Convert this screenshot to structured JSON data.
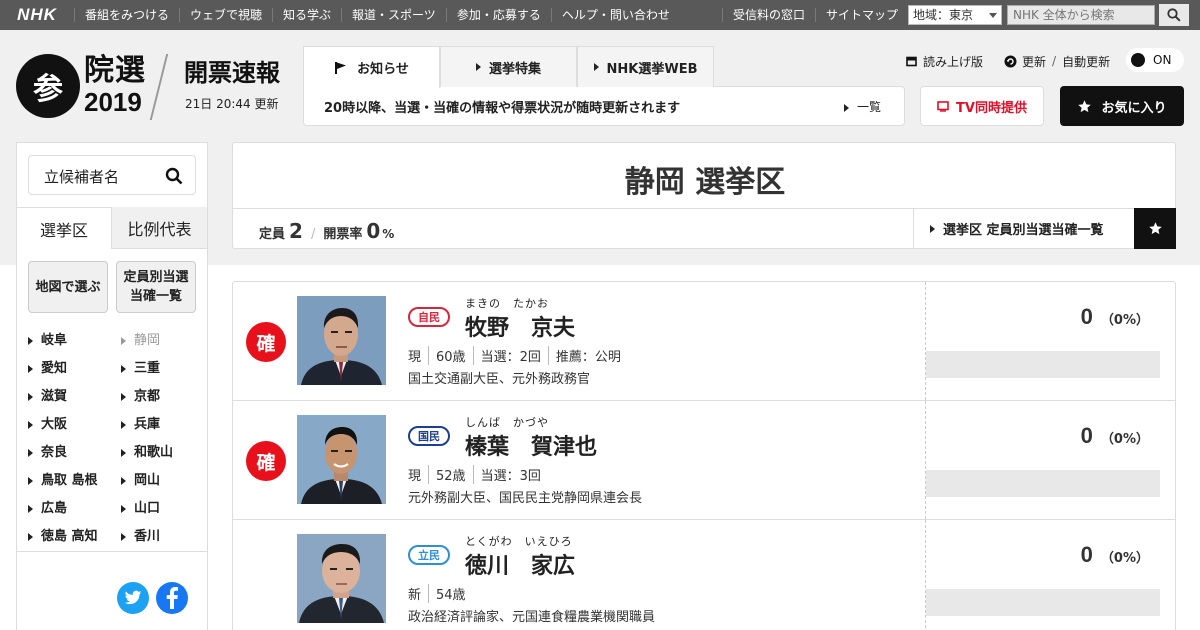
{
  "topbar": {
    "logo": "NHK",
    "nav": [
      "番組をみつける",
      "ウェブで視聴",
      "知る学ぶ",
      "報道・スポーツ",
      "参加・応募する",
      "ヘルプ・問い合わせ"
    ],
    "right_nav": [
      "受信料の窓口",
      "サイトマップ"
    ],
    "region_label": "地域：",
    "region_value": "東京",
    "search_placeholder": "NHK 全体から検索"
  },
  "header": {
    "logo_mark": "参",
    "logo_line1": "院選",
    "logo_line2": "2019",
    "title": "開票速報",
    "updated": "21日 20:44 更新",
    "tabs": [
      {
        "label": "お知らせ",
        "active": true
      },
      {
        "label": "選挙特集",
        "active": false
      },
      {
        "label": "NHK選挙WEB",
        "active": false
      }
    ],
    "news_text": "20時以降、当選・当確の情報や得票状況が随時更新されます",
    "news_list_link": "一覧",
    "read_aloud": "読み上げ版",
    "refresh": "更新",
    "auto_refresh": "自動更新",
    "toggle_state": "ON",
    "tv_button": "TV同時提供",
    "favorite_button": "お気に入り"
  },
  "sidebar": {
    "search_placeholder": "立候補者名",
    "tabs": [
      "選挙区",
      "比例代表"
    ],
    "buttons": [
      "地図で選ぶ",
      "定員別当選\n当確一覧"
    ],
    "prefectures": [
      [
        "岐阜",
        "静岡"
      ],
      [
        "愛知",
        "三重"
      ],
      [
        "滋賀",
        "京都"
      ],
      [
        "大阪",
        "兵庫"
      ],
      [
        "奈良",
        "和歌山"
      ],
      [
        "鳥取 島根",
        "岡山"
      ],
      [
        "広島",
        "山口"
      ],
      [
        "徳島 高知",
        "香川"
      ]
    ],
    "current_prefecture": "静岡"
  },
  "district": {
    "title": "静岡 選挙区",
    "seats_label": "定員",
    "seats": "2",
    "rate_label": "開票率",
    "rate": "0",
    "rate_unit": "%",
    "link": "選挙区 定員別当選当確一覧"
  },
  "candidates": [
    {
      "elected_mark": "確",
      "party": "自民",
      "party_color": "#d7263d",
      "kana": "まきの　たかお",
      "name": "牧野　京夫",
      "meta": [
        "現",
        "60歳",
        "当選：2回",
        "推薦：公明"
      ],
      "desc": "国土交通副大臣、元外務政務官",
      "votes": "0",
      "share": "（0%）",
      "share_value": 0
    },
    {
      "elected_mark": "確",
      "party": "国民",
      "party_color": "#1d3f8f",
      "kana": "しんば　かづや",
      "name": "榛葉　賀津也",
      "meta": [
        "現",
        "52歳",
        "当選：3回"
      ],
      "desc": "元外務副大臣、国民民主党静岡県連会長",
      "votes": "0",
      "share": "（0%）",
      "share_value": 0
    },
    {
      "elected_mark": "",
      "party": "立民",
      "party_color": "#2e8fd6",
      "kana": "とくがわ　いえひろ",
      "name": "徳川　家広",
      "meta": [
        "新",
        "54歳"
      ],
      "desc": "政治経済評論家、元国連食糧農業機関職員",
      "votes": "0",
      "share": "（0%）",
      "share_value": 0
    }
  ]
}
